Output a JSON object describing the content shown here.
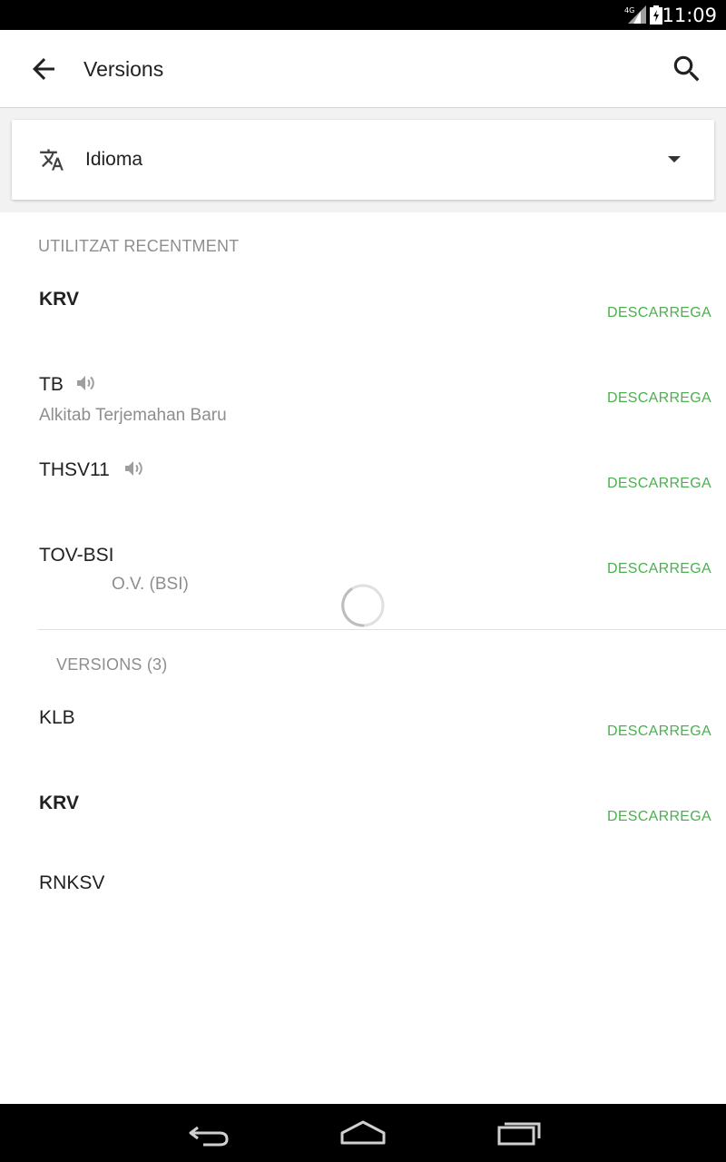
{
  "status_bar": {
    "network": "4G",
    "time": "11:09"
  },
  "toolbar": {
    "title": "Versions",
    "back_icon": "arrow-back-icon",
    "search_icon": "search-icon"
  },
  "language_selector": {
    "icon": "translate-icon",
    "label": "Idioma",
    "dropdown_icon": "arrow-drop-down-icon"
  },
  "recent": {
    "header": "UTILITZAT RECENTMENT",
    "items": [
      {
        "name": "KRV",
        "bold": true,
        "subtitle": "",
        "audio": false,
        "action": "DESCARREGA"
      },
      {
        "name": "TB",
        "bold": false,
        "subtitle": "Alkitab Terjemahan Baru",
        "audio": true,
        "action": "DESCARREGA"
      },
      {
        "name": "THSV11",
        "bold": false,
        "subtitle": "",
        "audio": true,
        "action": "DESCARREGA"
      },
      {
        "name": "TOV-BSI",
        "bold": false,
        "subtitle": "O.V. (BSI)",
        "audio": false,
        "action": "DESCARREGA"
      }
    ]
  },
  "versions": {
    "header": "VERSIONS (3)",
    "items": [
      {
        "name": "KLB",
        "bold": false,
        "action": "DESCARREGA"
      },
      {
        "name": "KRV",
        "bold": true,
        "action": "DESCARREGA"
      },
      {
        "name": "RNKSV",
        "bold": false,
        "action": ""
      }
    ]
  },
  "colors": {
    "accent_green": "#4caf50",
    "secondary_text": "#8e8e8e",
    "primary_text": "#212121"
  },
  "nav_bar": {
    "back": "nav-back-icon",
    "home": "nav-home-icon",
    "recents": "nav-recents-icon"
  }
}
